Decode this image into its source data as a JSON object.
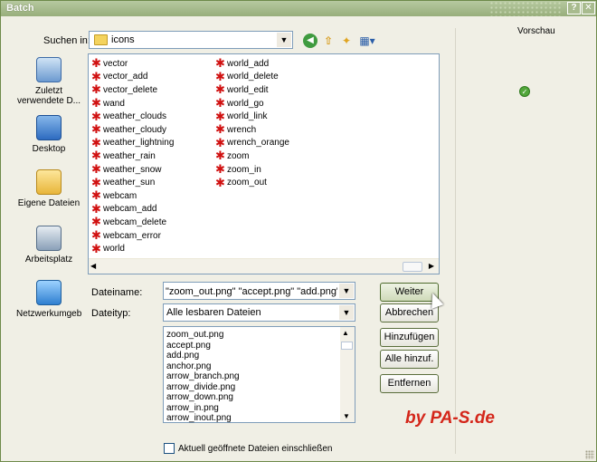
{
  "window": {
    "title": "Batch"
  },
  "toolbar": {
    "lookin_label": "Suchen in:",
    "lookin_value": "icons"
  },
  "places": [
    {
      "label": "Zuletzt verwendete D...",
      "icon": "recent-documents-icon"
    },
    {
      "label": "Desktop",
      "icon": "desktop-icon"
    },
    {
      "label": "Eigene Dateien",
      "icon": "my-documents-icon"
    },
    {
      "label": "Arbeitsplatz",
      "icon": "my-computer-icon"
    },
    {
      "label": "Netzwerkumgeb",
      "icon": "network-icon"
    }
  ],
  "files": {
    "col1": [
      "vector",
      "vector_add",
      "vector_delete",
      "wand",
      "weather_clouds",
      "weather_cloudy",
      "weather_lightning",
      "weather_rain",
      "weather_snow",
      "weather_sun",
      "webcam",
      "webcam_add",
      "webcam_delete",
      "webcam_error",
      "world"
    ],
    "col2": [
      "world_add",
      "world_delete",
      "world_edit",
      "world_go",
      "world_link",
      "wrench",
      "wrench_orange",
      "zoom",
      "zoom_in",
      "zoom_out"
    ]
  },
  "form": {
    "filename_label": "Dateiname:",
    "filename_value": "\"zoom_out.png\" \"accept.png\" \"add.png\" \"anc",
    "filetype_label": "Dateityp:",
    "filetype_value": "Alle lesbaren Dateien"
  },
  "selected_files": [
    "zoom_out.png",
    "accept.png",
    "add.png",
    "anchor.png",
    "arrow_branch.png",
    "arrow_divide.png",
    "arrow_down.png",
    "arrow_in.png",
    "arrow_inout.png"
  ],
  "buttons": {
    "weiter": "Weiter",
    "abbrechen": "Abbrechen",
    "hinzufuegen": "Hinzufügen",
    "alle_hinzu": "Alle hinzuf.",
    "entfernen": "Entfernen"
  },
  "preview_label": "Vorschau",
  "checkbox_label": "Aktuell geöffnete Dateien einschließen",
  "watermark": "by PA-S.de",
  "colors": {
    "titlebar": "#97ae7b",
    "watermark": "#d4261a",
    "file_icon": "#d01010"
  }
}
